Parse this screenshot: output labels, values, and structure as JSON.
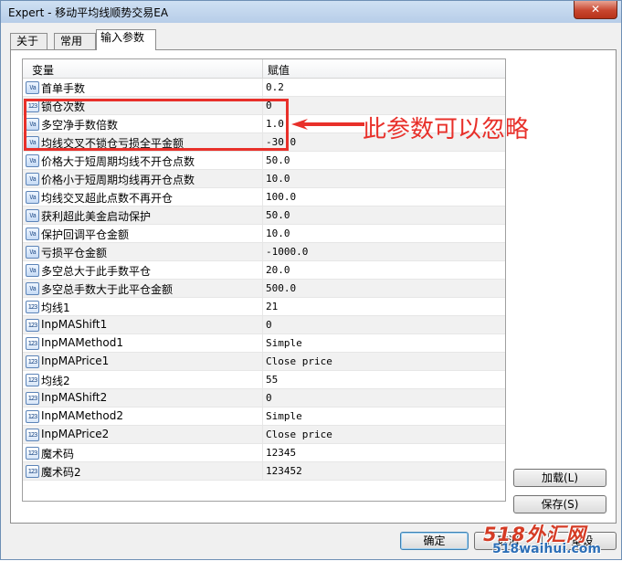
{
  "window": {
    "title": "Expert - 移动平均线顺势交易EA",
    "close_glyph": "✕"
  },
  "tabs": [
    {
      "label": "关于"
    },
    {
      "label": "常用"
    },
    {
      "label": "输入参数"
    }
  ],
  "grid": {
    "columns": {
      "variable": "变量",
      "value": "赋值"
    },
    "rows": [
      {
        "icon": "Va",
        "name": "首单手数",
        "value": "0.2"
      },
      {
        "icon": "123",
        "name": "锁仓次数",
        "value": "0"
      },
      {
        "icon": "Va",
        "name": "多空净手数倍数",
        "value": "1.0"
      },
      {
        "icon": "Va",
        "name": "均线交叉不锁仓亏损全平金额",
        "value": "-30.0"
      },
      {
        "icon": "Va",
        "name": "价格大于短周期均线不开仓点数",
        "value": "50.0"
      },
      {
        "icon": "Va",
        "name": "价格小于短周期均线再开仓点数",
        "value": "10.0"
      },
      {
        "icon": "Va",
        "name": "均线交叉超此点数不再开仓",
        "value": "100.0"
      },
      {
        "icon": "Va",
        "name": "获利超此美金启动保护",
        "value": "50.0"
      },
      {
        "icon": "Va",
        "name": "保护回调平仓金额",
        "value": "10.0"
      },
      {
        "icon": "Va",
        "name": "亏损平仓金额",
        "value": "-1000.0"
      },
      {
        "icon": "Va",
        "name": "多空总大于此手数平仓",
        "value": "20.0"
      },
      {
        "icon": "Va",
        "name": "多空总手数大于此平仓金额",
        "value": "500.0"
      },
      {
        "icon": "123",
        "name": "均线1",
        "value": "21"
      },
      {
        "icon": "123",
        "name": "InpMAShift1",
        "value": "0"
      },
      {
        "icon": "123",
        "name": "InpMAMethod1",
        "value": "Simple"
      },
      {
        "icon": "123",
        "name": "InpMAPrice1",
        "value": "Close price"
      },
      {
        "icon": "123",
        "name": "均线2",
        "value": "55"
      },
      {
        "icon": "123",
        "name": "InpMAShift2",
        "value": "0"
      },
      {
        "icon": "123",
        "name": "InpMAMethod2",
        "value": "Simple"
      },
      {
        "icon": "123",
        "name": "InpMAPrice2",
        "value": "Close price"
      },
      {
        "icon": "123",
        "name": "魔术码",
        "value": "12345"
      },
      {
        "icon": "123",
        "name": "魔术码2",
        "value": "123452"
      }
    ]
  },
  "side_buttons": {
    "load": "加载(L)",
    "save": "保存(S)"
  },
  "footer_buttons": {
    "ok": "确定",
    "cancel": "取消",
    "reset": "重设"
  },
  "annotation": {
    "text": "此参数可以忽略",
    "color": "#e8302a"
  },
  "watermark": {
    "line1": "518外汇网",
    "line2": "518waihui.com"
  }
}
